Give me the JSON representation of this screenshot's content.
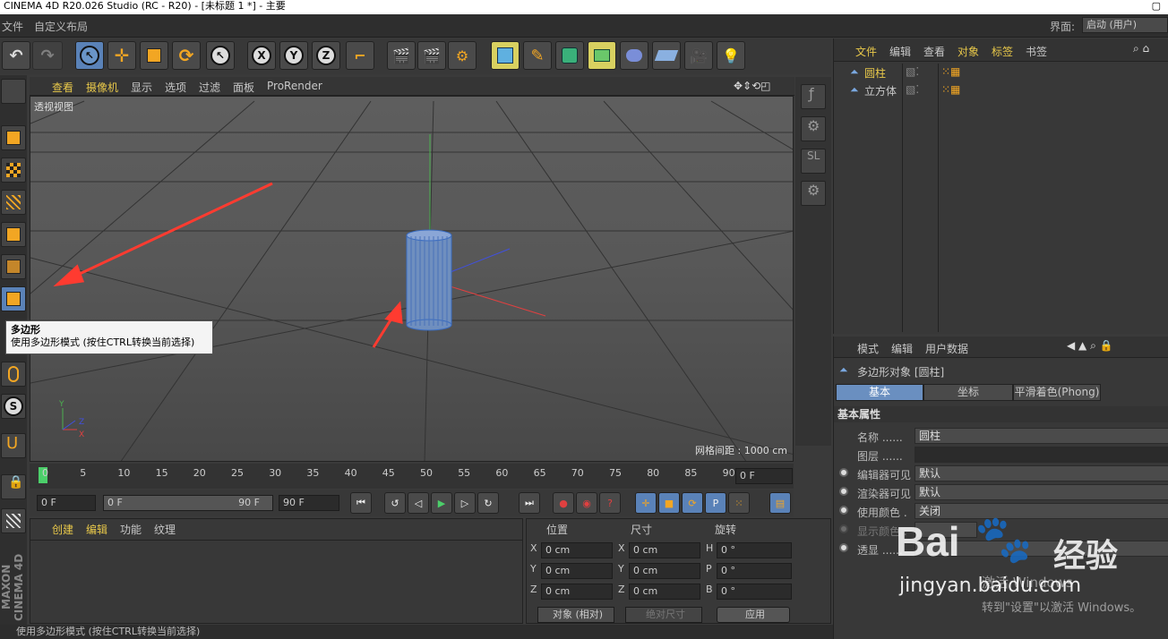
{
  "titlebar": {
    "title": "CINEMA 4D R20.026 Studio (RC - R20) - [未标题 1 *] - 主要"
  },
  "menubar": {
    "items": [
      "文件",
      "自定义布局"
    ],
    "layout_label": "界面:",
    "layout_value": "启动 (用户)"
  },
  "viewport": {
    "menu": [
      "查看",
      "摄像机",
      "显示",
      "选项",
      "过滤",
      "面板",
      "ProRender"
    ],
    "label": "透视视图",
    "grid_spacing": "网格间距 : 1000 cm"
  },
  "tooltip": {
    "title": "多边形",
    "body": "使用多边形模式 (按住CTRL转换当前选择)"
  },
  "timeline": {
    "ticks": [
      "0",
      "5",
      "10",
      "15",
      "20",
      "25",
      "30",
      "35",
      "40",
      "45",
      "50",
      "55",
      "60",
      "65",
      "70",
      "75",
      "80",
      "85",
      "90"
    ],
    "current_frame": "0 F"
  },
  "playbar": {
    "start": "0 F",
    "range_start": "0 F",
    "range_end": "90 F",
    "end": "90 F"
  },
  "material_panel": {
    "tabs": [
      "创建",
      "编辑",
      "功能",
      "纹理"
    ]
  },
  "coord_panel": {
    "headers": [
      "位置",
      "尺寸",
      "旋转"
    ],
    "rows": [
      {
        "axis": "X",
        "pos": "0 cm",
        "size_axis": "X",
        "size": "0 cm",
        "rot_axis": "H",
        "rot": "0 °"
      },
      {
        "axis": "Y",
        "pos": "0 cm",
        "size_axis": "Y",
        "size": "0 cm",
        "rot_axis": "P",
        "rot": "0 °"
      },
      {
        "axis": "Z",
        "pos": "0 cm",
        "size_axis": "Z",
        "size": "0 cm",
        "rot_axis": "B",
        "rot": "0 °"
      }
    ],
    "mode": "对象 (相对)",
    "size_mode": "绝对尺寸",
    "apply": "应用"
  },
  "status": {
    "text": "使用多边形模式 (按住CTRL转换当前选择)"
  },
  "object_panel": {
    "menu": [
      "文件",
      "编辑",
      "查看",
      "对象",
      "标签",
      "书签"
    ],
    "objects": [
      "圆柱",
      "立方体"
    ]
  },
  "attr_panel": {
    "menu": [
      "模式",
      "编辑",
      "用户数据"
    ],
    "object_title": "多边形对象 [圆柱]",
    "tabs": [
      "基本",
      "坐标",
      "平滑着色(Phong)"
    ],
    "section": "基本属性",
    "rows": [
      {
        "label": "名称 ......",
        "value": "圆柱"
      },
      {
        "label": "图层 ......",
        "value": ""
      },
      {
        "label": "编辑器可见",
        "value": "默认"
      },
      {
        "label": "渲染器可见",
        "value": "默认"
      },
      {
        "label": "使用颜色 .",
        "value": "关闭"
      },
      {
        "label": "显示颜色 .",
        "value": ""
      },
      {
        "label": "透显 ......",
        "value": ""
      }
    ]
  },
  "watermark": {
    "brand": "Bai",
    "brand2": "经验",
    "url": "jingyan.baidu.com",
    "activate1": "激活 Windows",
    "activate2": "转到\"设置\"以激活 Windows。"
  },
  "colors": {
    "accent": "#5a82b8",
    "highlight_text": "#e8c84a",
    "arrow": "#ff3b30"
  }
}
